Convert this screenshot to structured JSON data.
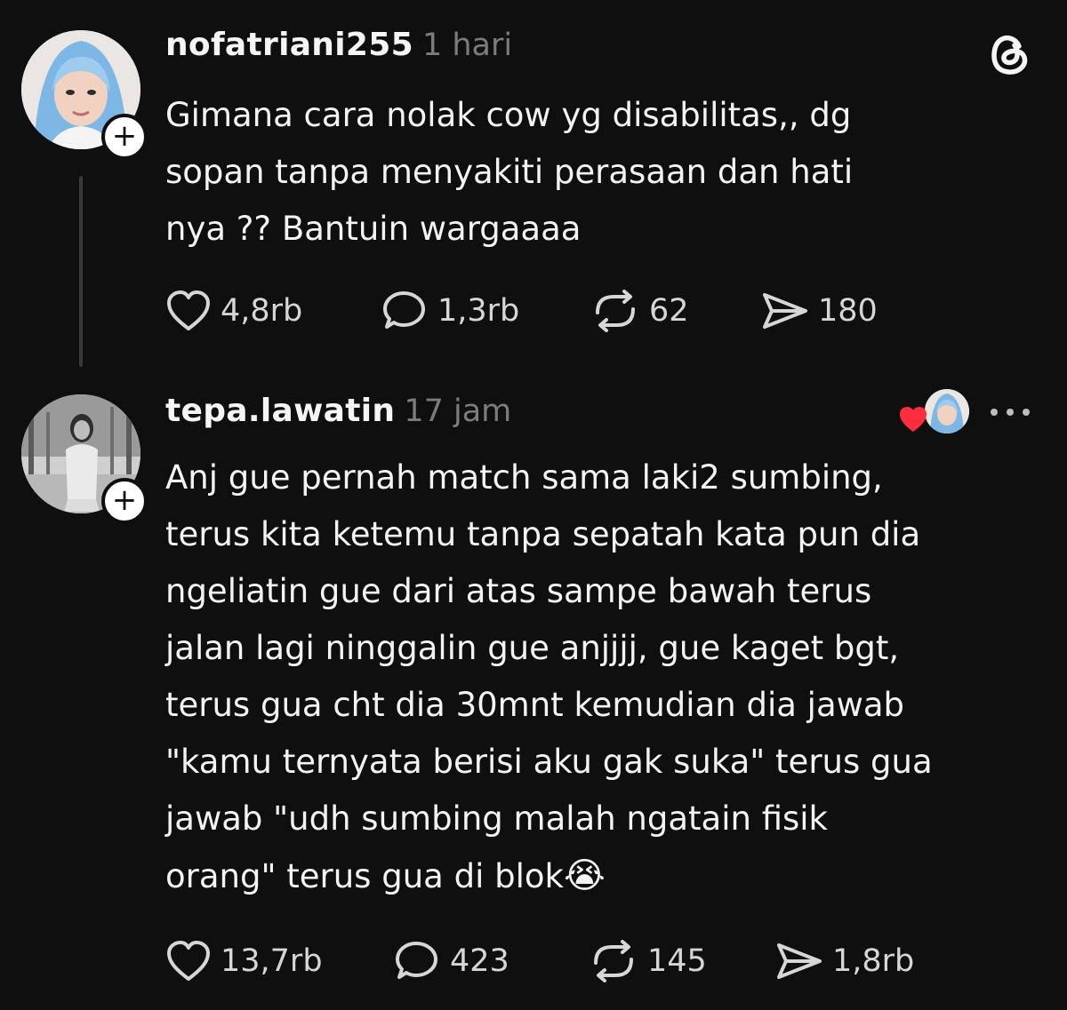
{
  "posts": [
    {
      "username": "nofatriani255",
      "time": "1 hari",
      "text": "Gimana cara nolak cow yg disabilitas,, dg\nsopan tanpa menyakiti perasaan dan hati\nnya ?? Bantuin wargaaaa",
      "likes": "4,8rb",
      "replies": "1,3rb",
      "reposts": "62",
      "shares": "180"
    },
    {
      "username": "tepa.lawatin",
      "time": "17 jam",
      "text": "Anj gue pernah match sama laki2  sumbing,\nterus kita ketemu tanpa sepatah kata pun dia\nngeliatin gue dari atas sampe bawah terus\njalan lagi ninggalin gue anjjjj, gue kaget bgt,\nterus gua cht dia 30mnt kemudian dia jawab\n\"kamu ternyata berisi aku gak suka\" terus gua\njawab \"udh sumbing malah ngatain fisik\norang\" terus gua di blok",
      "emoji": "😭",
      "likes": "13,7rb",
      "replies": "423",
      "reposts": "145",
      "shares": "1,8rb"
    }
  ],
  "icons": {
    "app_logo": "threads-logo-icon",
    "more": "more-options-icon",
    "like": "heart-icon",
    "reply": "comment-icon",
    "repost": "repost-icon",
    "share": "share-icon"
  },
  "colors": {
    "background": "#0f0f0f",
    "text": "#f3f3f3",
    "muted": "#7c7c7c",
    "heart_red": "#ff2d3d"
  }
}
